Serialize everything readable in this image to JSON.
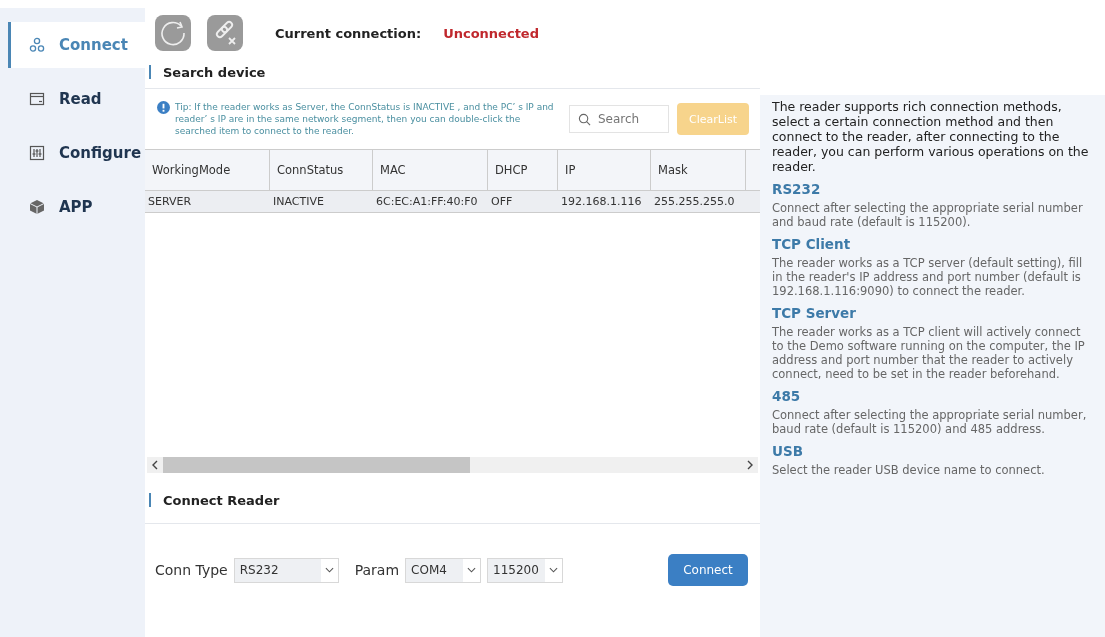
{
  "sidebar": {
    "items": [
      {
        "label": "Connect",
        "selected": true
      },
      {
        "label": "Read",
        "selected": false
      },
      {
        "label": "Configure",
        "selected": false
      },
      {
        "label": "APP",
        "selected": false
      }
    ]
  },
  "toolbar": {
    "connection_label": "Current connection:",
    "connection_status": "Unconnected"
  },
  "search_device": {
    "heading": "Search device",
    "tip": "Tip: If the reader works as Server, the ConnStatus is INACTIVE , and the PC’ s IP and reader’ s IP are in the same network segment, then you can double-click the searched item to connect to the reader.",
    "search": {
      "placeholder": "Search"
    },
    "clear_button": "ClearList",
    "table": {
      "columns": [
        "WorkingMode",
        "ConnStatus",
        "MAC",
        "DHCP",
        "IP",
        "Mask"
      ],
      "rows": [
        {
          "cells": [
            "SERVER",
            "INACTIVE",
            "6C:EC:A1:FF:40:F0",
            "OFF",
            "192.168.1.116",
            "255.255.255.0"
          ],
          "selected": true
        }
      ]
    }
  },
  "connect_reader": {
    "heading": "Connect Reader",
    "conn_type_label": "Conn Type",
    "conn_type": "RS232",
    "param_label": "Param",
    "port": "COM4",
    "baud": "115200",
    "connect_button": "Connect"
  },
  "help": {
    "intro": "The reader supports rich connection methods, select a certain connection method and then connect to the reader, after connecting to the reader, you can perform various operations on the reader.",
    "sections": [
      {
        "title": "RS232",
        "text": "Connect after selecting the appropriate serial number and baud rate (default is 115200)."
      },
      {
        "title": "TCP Client",
        "text": "The reader works as a TCP server (default setting), fill in the reader's IP address and port number (default is 192.168.1.116:9090) to connect the reader."
      },
      {
        "title": "TCP Server",
        "text": "The reader works as a TCP client will actively connect to the Demo software running on the computer, the IP address and port number that the reader to actively connect, need  to be set in the reader beforehand."
      },
      {
        "title": "485",
        "text": "Connect after selecting the appropriate serial number, baud rate (default is 115200) and 485 address."
      },
      {
        "title": "USB",
        "text": "Select the reader USB device name to connect."
      }
    ]
  }
}
